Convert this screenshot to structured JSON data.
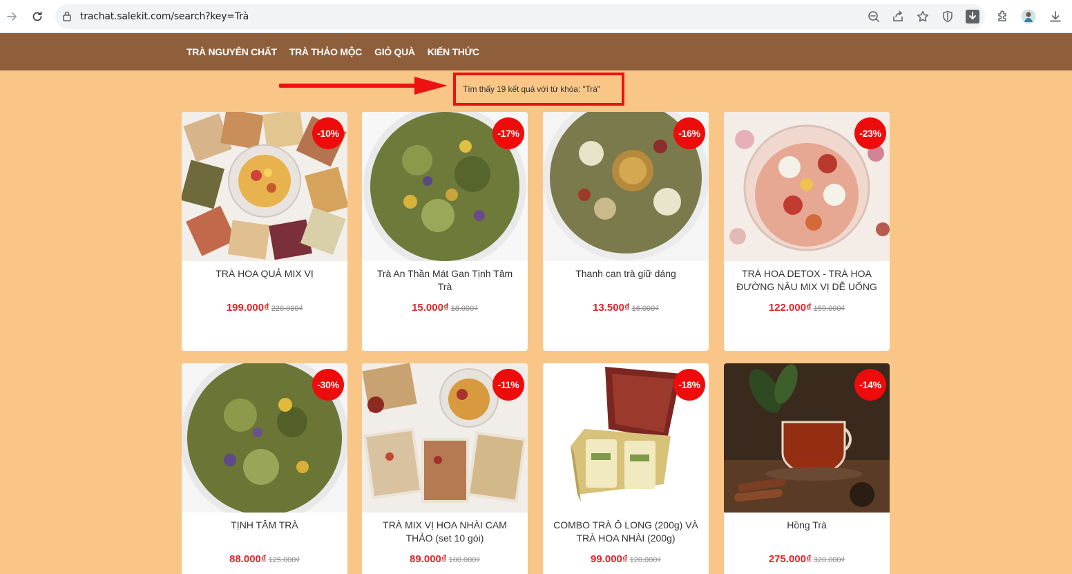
{
  "browser": {
    "url": "trachat.salekit.com/search?key=Trà"
  },
  "nav": {
    "items": [
      {
        "label": "TRÀ NGUYÊN CHẤT"
      },
      {
        "label": "TRÀ THẢO MỘC"
      },
      {
        "label": "GIỎ QUÀ"
      },
      {
        "label": "KIẾN THỨC"
      }
    ]
  },
  "search": {
    "result_text": "Tìm thấy 19 kết quả với từ khóa: \"Trà\""
  },
  "colors": {
    "header": "#8f5f3c",
    "page_background": "#f9c688",
    "badge": "#ee0b0b",
    "price": "#e3242b",
    "highlight_box": "#ee1111"
  },
  "products": [
    {
      "name": "TRÀ HOA QUẢ MIX VỊ",
      "price": "199.000₫",
      "old_price": "220.000₫",
      "discount": "-10%"
    },
    {
      "name": "Trà An Thần Mát Gan Tịnh Tâm Trà",
      "price": "15.000₫",
      "old_price": "18.000₫",
      "discount": "-17%"
    },
    {
      "name": "Thanh can trà giữ dáng",
      "price": "13.500₫",
      "old_price": "16.000₫",
      "discount": "-16%"
    },
    {
      "name": "TRÀ HOA DETOX - TRÀ HOA ĐƯỜNG NÂU MIX VỊ DỄ UỐNG",
      "price": "122.000₫",
      "old_price": "159.000₫",
      "discount": "-23%"
    },
    {
      "name": "TỊNH TÂM TRÀ",
      "price": "88.000₫",
      "old_price": "125.000₫",
      "discount": "-30%"
    },
    {
      "name": "TRÀ MIX VỊ HOA NHÀI CAM THẢO (set 10 gói)",
      "price": "89.000₫",
      "old_price": "100.000₫",
      "discount": "-11%"
    },
    {
      "name": "COMBO TRÀ Ô LONG (200g) VÀ TRÀ HOA NHÀI (200g)",
      "price": "99.000₫",
      "old_price": "120.000₫",
      "discount": "-18%"
    },
    {
      "name": "Hồng Trà",
      "price": "275.000₫",
      "old_price": "320.000₫",
      "discount": "-14%"
    }
  ]
}
